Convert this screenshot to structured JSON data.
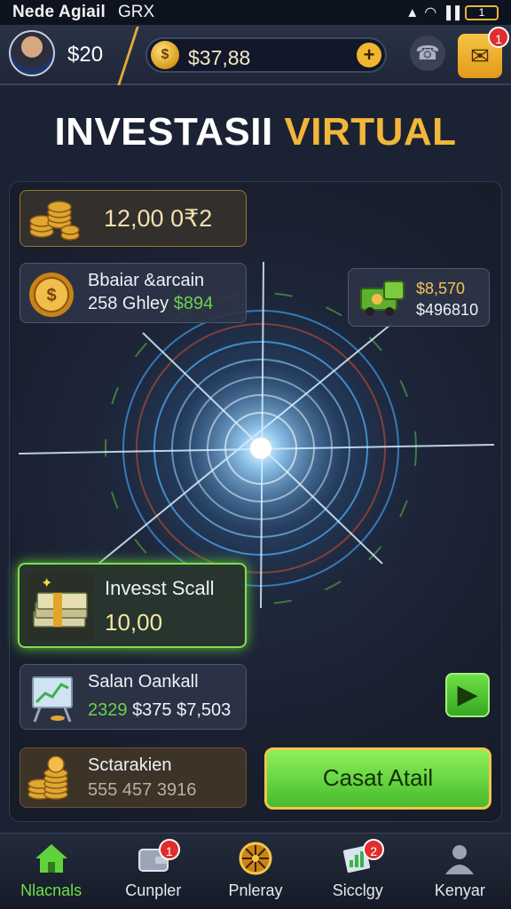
{
  "status_bar": {
    "carrier": "Nede Agiail",
    "network": "GRX",
    "battery": "1"
  },
  "header": {
    "user_balance": "$20",
    "coin_balance": "$37,88",
    "mail_badge": "1"
  },
  "title": {
    "part1": "INVESTASII",
    "part2": "VIRTUAL"
  },
  "cards": {
    "coins": {
      "amount": "12,00 0₹2"
    },
    "bazaar": {
      "line1": "Bbaiar &arcain",
      "line2_prefix": "258 Ghley",
      "line2_value": "$894"
    },
    "truck": {
      "line1": "$8,570",
      "line2": "$496810"
    },
    "invest": {
      "label": "Invesst Scall",
      "amount": "10,00"
    },
    "salary": {
      "line1": "Salan Oankall",
      "value_a": "2329",
      "value_b": "$375 $7,503"
    },
    "tracker": {
      "line1": "Sctarakien",
      "line2": "555 457 3916"
    }
  },
  "cta": {
    "label": "Casat Atail"
  },
  "bottom_nav": [
    {
      "label": "Nlacnals",
      "icon": "home-icon",
      "active": true
    },
    {
      "label": "Cunpler",
      "icon": "wallet-icon",
      "badge": "1"
    },
    {
      "label": "Pnleray",
      "icon": "wheel-icon"
    },
    {
      "label": "Sicclgy",
      "icon": "chart-icon",
      "badge": "2"
    },
    {
      "label": "Kenyar",
      "icon": "profile-icon"
    }
  ],
  "colors": {
    "accent_gold": "#f2b739",
    "accent_green": "#6fd24b",
    "background": "#1b2233"
  }
}
